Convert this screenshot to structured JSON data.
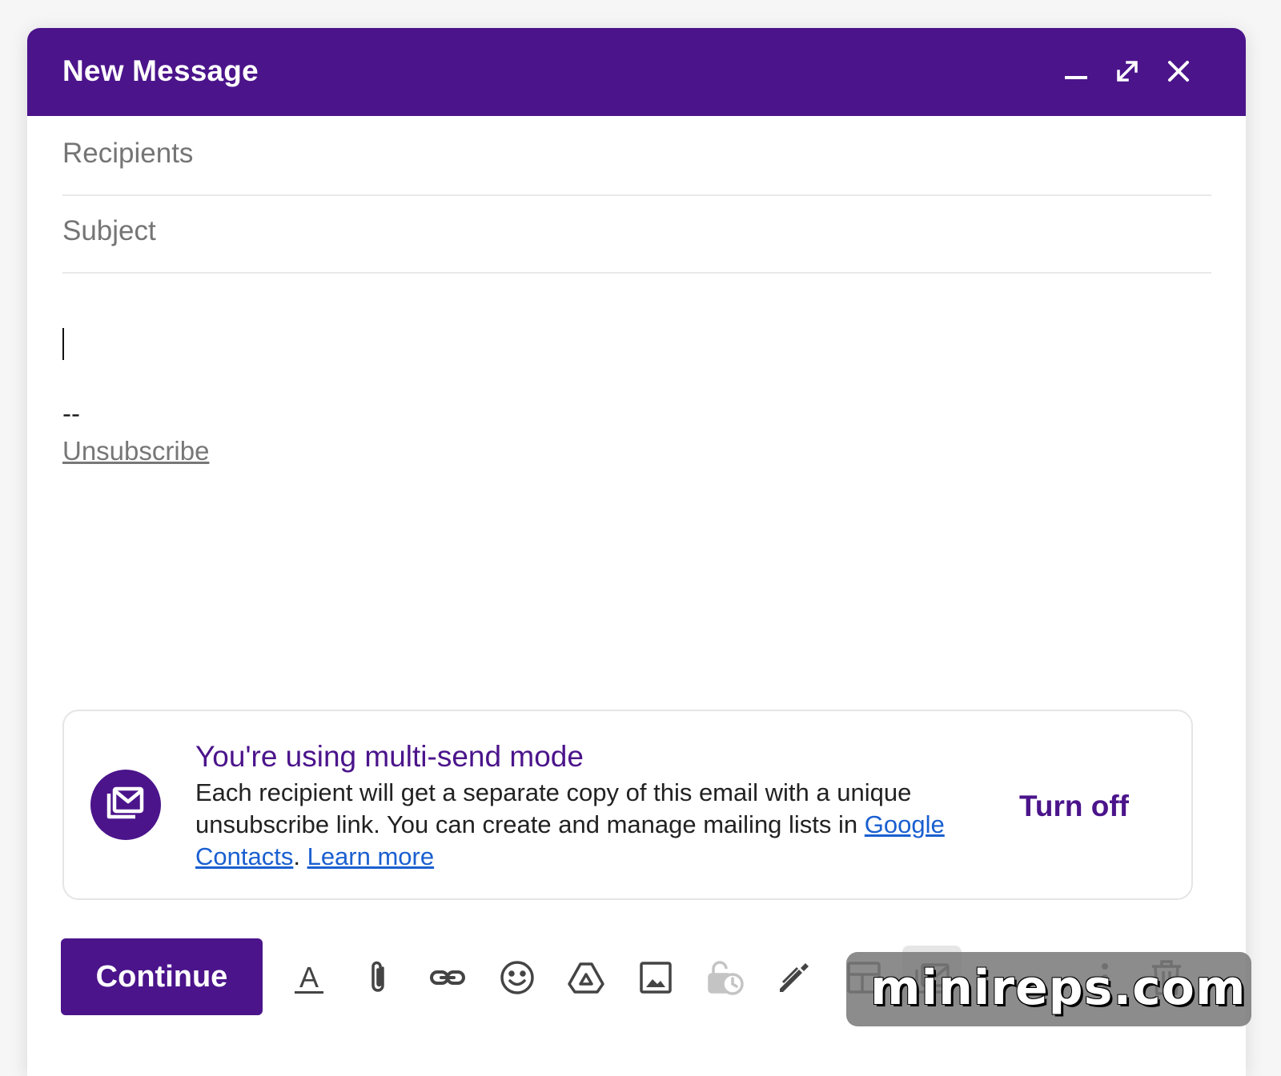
{
  "window": {
    "title": "New Message",
    "controls": {
      "minimize": "minimize-icon",
      "expand": "expand-icon",
      "close": "close-icon"
    }
  },
  "fields": {
    "recipients_placeholder": "Recipients",
    "recipients_value": "",
    "subject_placeholder": "Subject",
    "subject_value": ""
  },
  "body": {
    "text": "",
    "signature_separator": "--",
    "unsubscribe_label": "Unsubscribe"
  },
  "banner": {
    "title": "You're using multi-send mode",
    "text_before": "Each recipient will get a separate copy of this email with a unique unsubscribe link. You can create and manage mailing lists in ",
    "contacts_link": "Google Contacts",
    "separator": ". ",
    "learn_more": "Learn more",
    "turn_off": "Turn off"
  },
  "toolbar": {
    "continue_label": "Continue",
    "icons": [
      "format-text-icon",
      "attach-icon",
      "link-icon",
      "emoji-icon",
      "drive-icon",
      "photo-icon",
      "confidential-mode-icon",
      "signature-pen-icon",
      "layout-icon",
      "multi-send-icon",
      "more-options-icon",
      "delete-icon"
    ]
  },
  "watermark": {
    "text": "minireps.com"
  },
  "colors": {
    "accent": "#4b148b",
    "link": "#1a5fd0",
    "placeholder": "#757575"
  }
}
